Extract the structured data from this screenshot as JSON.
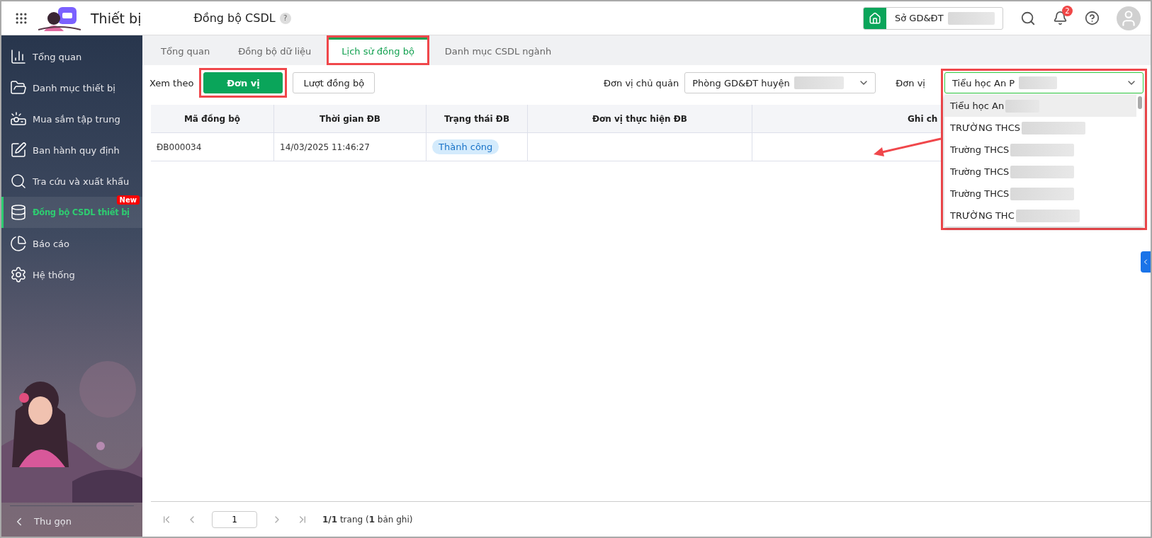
{
  "app": {
    "title": "Thiết bị"
  },
  "page": {
    "title": "Đồng bộ CSDL",
    "help": "?"
  },
  "unit_switch": {
    "label": "Sở GD&ĐT",
    "redacted": true
  },
  "notifications": {
    "count": "2"
  },
  "sidebar": {
    "items": [
      {
        "kind": "chart",
        "label": "Tổng quan",
        "selected": false
      },
      {
        "kind": "folder",
        "label": "Danh mục thiết bị",
        "selected": false
      },
      {
        "kind": "projector",
        "label": "Mua sắm tập trung",
        "selected": false
      },
      {
        "kind": "edit",
        "label": "Ban hành quy định",
        "selected": false
      },
      {
        "kind": "search",
        "label": "Tra cứu và xuất khẩu",
        "selected": false
      },
      {
        "kind": "database",
        "label": "Đồng bộ CSDL thiết bị",
        "selected": true,
        "badge": "New"
      },
      {
        "kind": "pie",
        "label": "Báo cáo",
        "selected": false
      },
      {
        "kind": "gear",
        "label": "Hệ thống",
        "selected": false
      }
    ],
    "collapse": "Thu gọn"
  },
  "tabs": [
    {
      "label": "Tổng quan",
      "selected": false,
      "annotated": false
    },
    {
      "label": "Đồng bộ dữ liệu",
      "selected": false,
      "annotated": false
    },
    {
      "label": "Lịch sử đồng bộ",
      "selected": true,
      "annotated": true
    },
    {
      "label": "Danh mục CSDL ngành",
      "selected": false,
      "annotated": false
    }
  ],
  "view_by": {
    "label": "Xem theo",
    "options": [
      {
        "label": "Đơn vị",
        "selected": true,
        "annotated": true
      },
      {
        "label": "Lượt đồng bộ",
        "selected": false,
        "annotated": false
      }
    ]
  },
  "filters": [
    {
      "label": "Đơn vị chủ quản",
      "value": "Phòng GD&ĐT huyện",
      "redacted": true
    },
    {
      "label": "Đơn vị",
      "value": "Tiểu học An P",
      "redacted": true,
      "open": true
    }
  ],
  "dropdown": {
    "options": [
      {
        "label": "Tiểu học An",
        "selected": true,
        "redacted": true
      },
      {
        "label": "TRƯỜNG THCS",
        "selected": false,
        "redacted": true
      },
      {
        "label": "Trường THCS",
        "selected": false,
        "redacted": true
      },
      {
        "label": "Trường THCS",
        "selected": false,
        "redacted": true
      },
      {
        "label": "Trường THCS",
        "selected": false,
        "redacted": true
      },
      {
        "label": "TRƯỜNG THC",
        "selected": false,
        "redacted": true
      }
    ]
  },
  "table": {
    "columns": [
      "Mã đồng bộ",
      "Thời gian ĐB",
      "Trạng thái ĐB",
      "Đơn vị thực hiện ĐB",
      "Ghi ch"
    ],
    "rows": [
      {
        "code": "ĐB000034",
        "time": "14/03/2025 11:46:27",
        "status": "Thành công"
      }
    ]
  },
  "pagination": {
    "page": "1",
    "summary": "**1/1** trang (**1** bản ghi)"
  }
}
